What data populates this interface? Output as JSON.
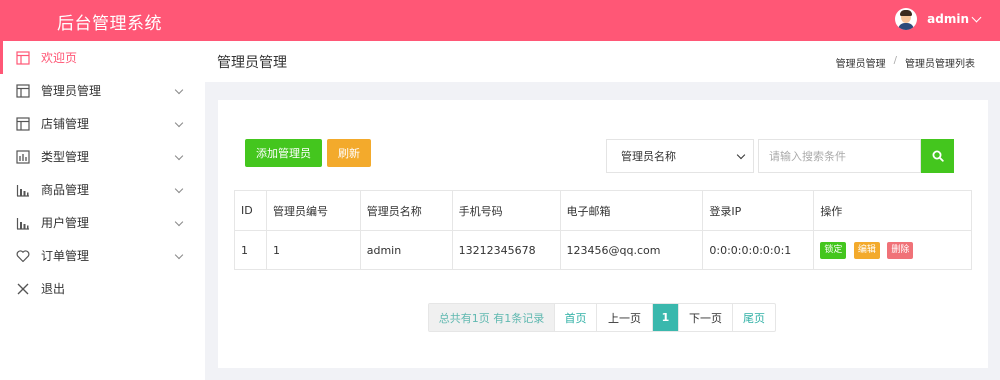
{
  "header": {
    "brand": "后台管理系统",
    "user_name": "admin",
    "accent_color": "#ff5776"
  },
  "sidebar": {
    "items": [
      {
        "label": "欢迎页",
        "icon": "layout-icon",
        "active": true
      },
      {
        "label": "管理员管理",
        "icon": "layout-icon",
        "expandable": true
      },
      {
        "label": "店铺管理",
        "icon": "layout-icon",
        "expandable": true
      },
      {
        "label": "类型管理",
        "icon": "bar-chart-icon",
        "expandable": true
      },
      {
        "label": "商品管理",
        "icon": "bar-chart-icon",
        "expandable": true
      },
      {
        "label": "用户管理",
        "icon": "bar-chart-icon",
        "expandable": true
      },
      {
        "label": "订单管理",
        "icon": "heart-icon",
        "expandable": true
      },
      {
        "label": "退出",
        "icon": "close-icon"
      }
    ]
  },
  "page": {
    "title": "管理员管理",
    "breadcrumb": [
      "管理员管理",
      "管理员管理列表"
    ]
  },
  "toolbar": {
    "add_label": "添加管理员",
    "refresh_label": "刷新",
    "search_field_selected": "管理员名称",
    "search_placeholder": "请输入搜索条件",
    "search_icon": "search-icon"
  },
  "table": {
    "columns": [
      "ID",
      "管理员编号",
      "管理员名称",
      "手机号码",
      "电子邮箱",
      "登录IP",
      "操作"
    ],
    "rows": [
      {
        "id": "1",
        "number": "1",
        "name": "admin",
        "phone": "13212345678",
        "email": "123456@qq.com",
        "ip": "0:0:0:0:0:0:0:1",
        "actions": [
          "锁定",
          "编辑",
          "删除"
        ]
      }
    ]
  },
  "pagination": {
    "info": "总共有1页  有1条记录",
    "first": "首页",
    "prev": "上一页",
    "current": "1",
    "next": "下一页",
    "last": "尾页"
  }
}
